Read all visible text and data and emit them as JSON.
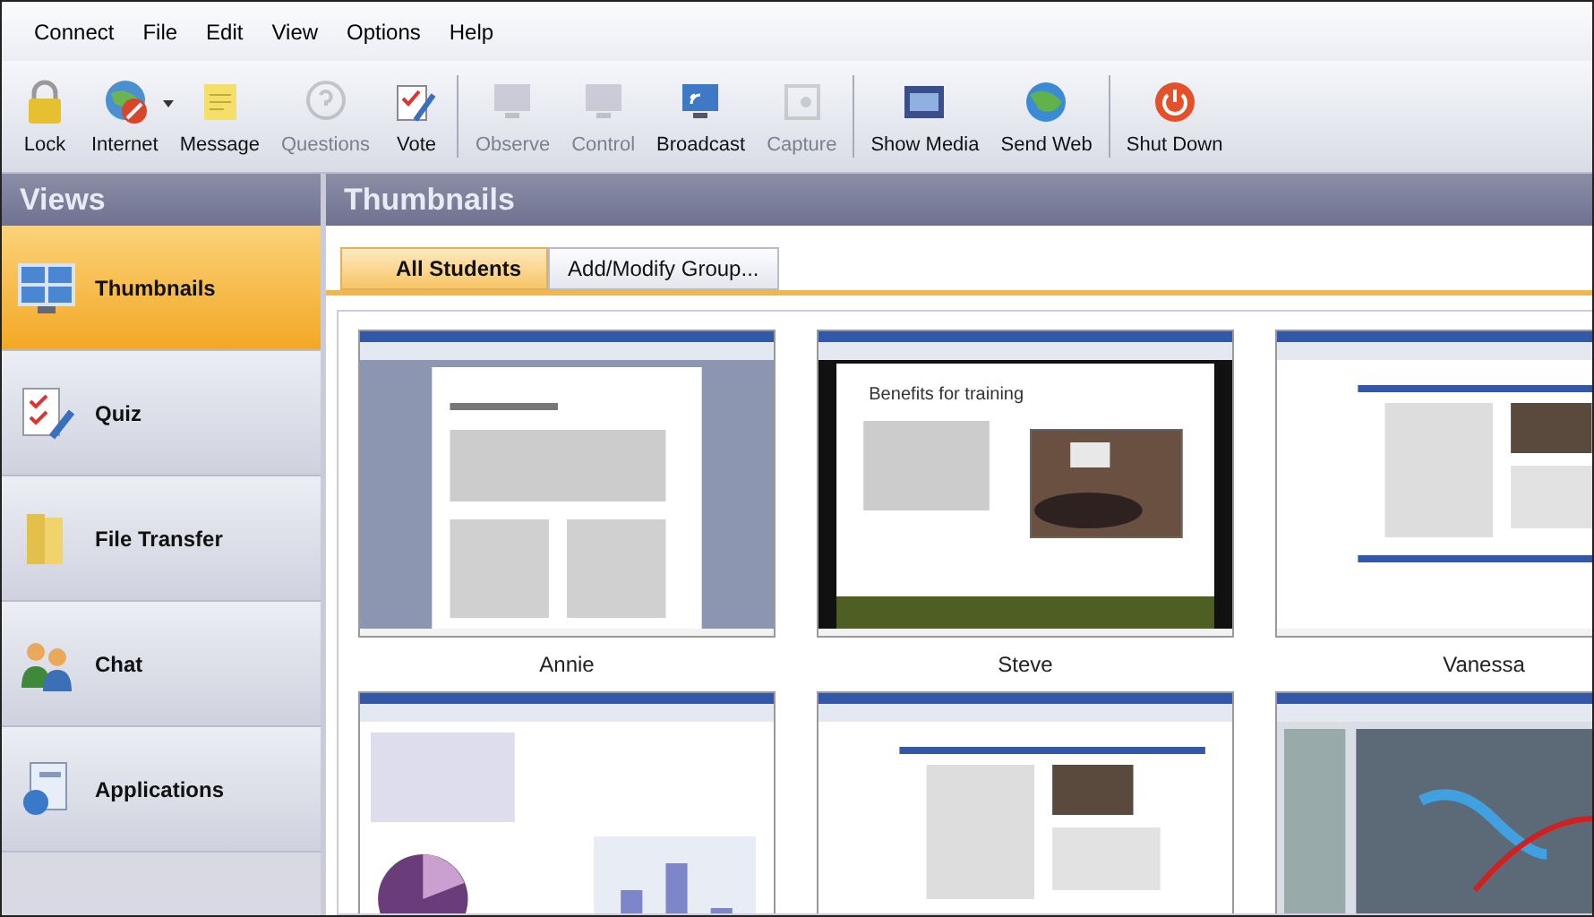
{
  "menu": [
    "Connect",
    "File",
    "Edit",
    "View",
    "Options",
    "Help"
  ],
  "toolbar": [
    {
      "kind": "button",
      "label": "Lock",
      "disabled": false
    },
    {
      "kind": "button",
      "label": "Internet",
      "disabled": false,
      "dropdown": true
    },
    {
      "kind": "button",
      "label": "Message",
      "disabled": false
    },
    {
      "kind": "button",
      "label": "Questions",
      "disabled": true
    },
    {
      "kind": "button",
      "label": "Vote",
      "disabled": false
    },
    {
      "kind": "separator"
    },
    {
      "kind": "button",
      "label": "Observe",
      "disabled": true
    },
    {
      "kind": "button",
      "label": "Control",
      "disabled": true
    },
    {
      "kind": "button",
      "label": "Broadcast",
      "disabled": false
    },
    {
      "kind": "button",
      "label": "Capture",
      "disabled": true
    },
    {
      "kind": "separator"
    },
    {
      "kind": "button",
      "label": "Show Media",
      "disabled": false
    },
    {
      "kind": "button",
      "label": "Send Web",
      "disabled": false
    },
    {
      "kind": "separator"
    },
    {
      "kind": "button",
      "label": "Shut Down",
      "disabled": false
    }
  ],
  "sidebar": {
    "title": "Views",
    "items": [
      {
        "label": "Thumbnails",
        "selected": true
      },
      {
        "label": "Quiz",
        "selected": false
      },
      {
        "label": "File Transfer",
        "selected": false
      },
      {
        "label": "Chat",
        "selected": false
      },
      {
        "label": "Applications",
        "selected": false
      }
    ]
  },
  "content": {
    "title": "Thumbnails",
    "tabs": [
      {
        "label": "All Students",
        "selected": true
      },
      {
        "label": "Add/Modify Group...",
        "selected": false
      }
    ],
    "students": [
      {
        "name": "Annie",
        "kind": "picture"
      },
      {
        "name": "Steve",
        "kind": "picture",
        "slide_title": "Benefits for training"
      },
      {
        "name": "Vanessa",
        "kind": "picture"
      },
      {
        "kind": "picture"
      },
      {
        "kind": "picture"
      },
      {
        "kind": "picture"
      }
    ]
  }
}
